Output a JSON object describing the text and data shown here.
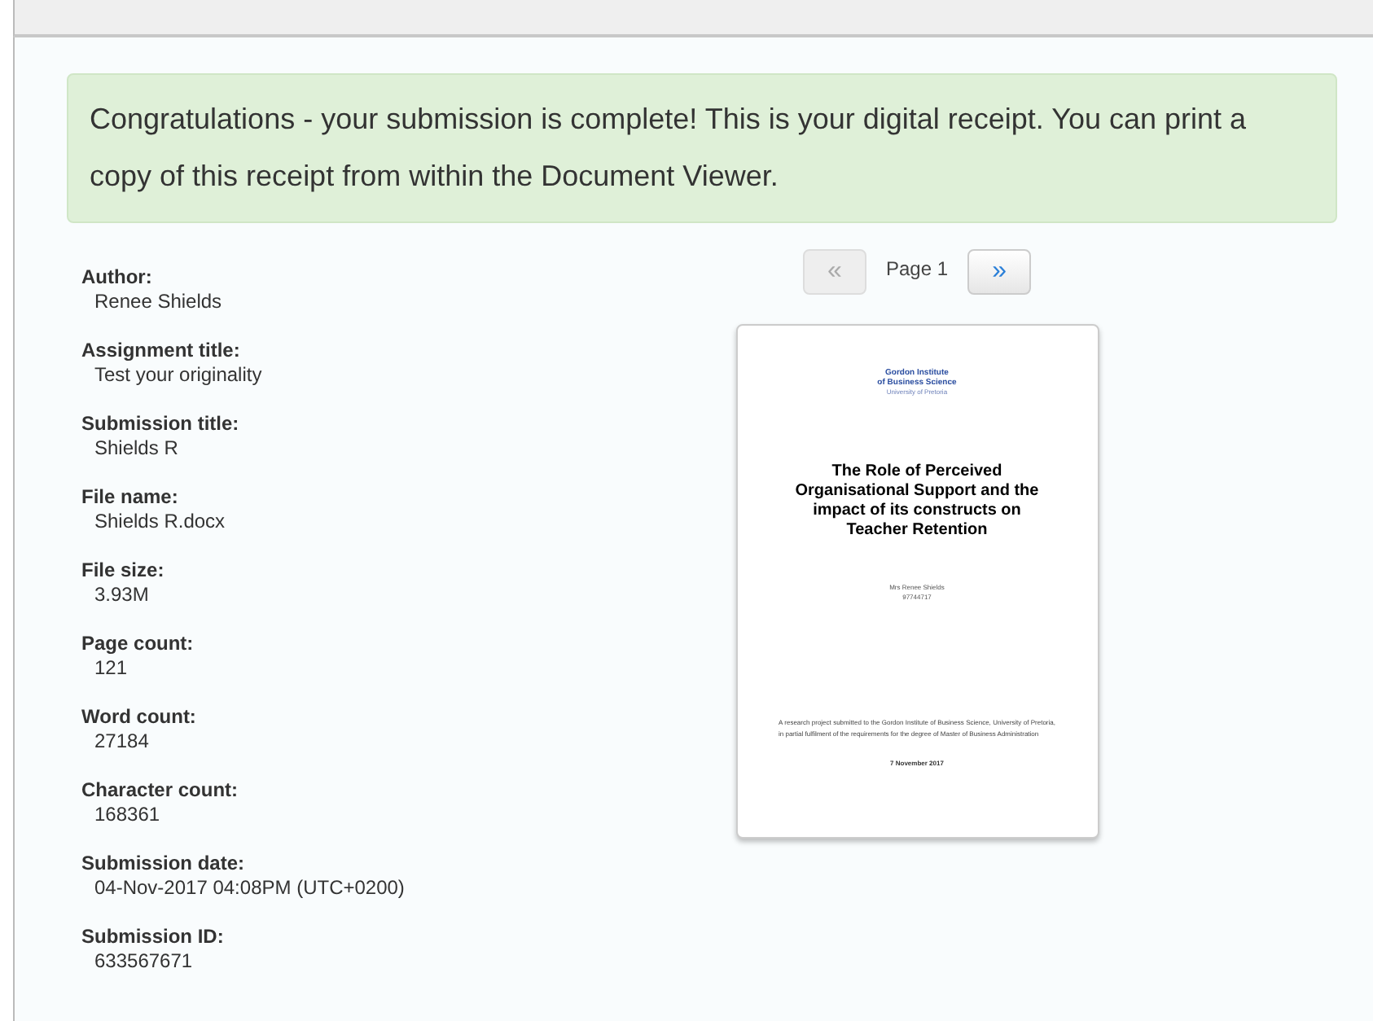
{
  "alert": {
    "message": "Congratulations - your submission is complete! This is your digital receipt. You can print a copy of this receipt from within the Document Viewer."
  },
  "fields": [
    {
      "label": "Author:",
      "value": "Renee Shields"
    },
    {
      "label": "Assignment title:",
      "value": "Test your originality"
    },
    {
      "label": "Submission title:",
      "value": "Shields R"
    },
    {
      "label": "File name:",
      "value": "Shields R.docx"
    },
    {
      "label": "File size:",
      "value": "3.93M"
    },
    {
      "label": "Page count:",
      "value": "121"
    },
    {
      "label": "Word count:",
      "value": "27184"
    },
    {
      "label": "Character count:",
      "value": "168361"
    },
    {
      "label": "Submission date:",
      "value": "04-Nov-2017 04:08PM (UTC+0200)"
    },
    {
      "label": "Submission ID:",
      "value": "633567671"
    }
  ],
  "pager": {
    "prev": {
      "label": "«",
      "disabled": true
    },
    "page": "Page 1",
    "next": {
      "label": "»",
      "disabled": false
    }
  },
  "document": {
    "logo_lines": [
      "Gordon Institute",
      "of Business Science",
      "University of Pretoria"
    ],
    "title": "The Role of Perceived Organisational Support and the impact of its constructs on Teacher Retention",
    "author": "Mrs Renee Shields",
    "student_number": "97744717",
    "statement": "A research project submitted to the Gordon Institute of Business Science, University of Pretoria, in partial fulfilment of the requirements for the degree of Master of Business Administration",
    "date": "7 November 2017"
  }
}
